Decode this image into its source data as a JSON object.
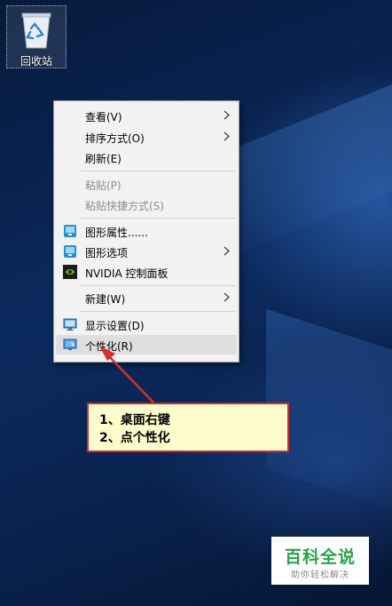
{
  "desktop": {
    "recycle_bin_label": "回收站"
  },
  "context_menu": {
    "items": [
      {
        "label": "查看(V)"
      },
      {
        "label": "排序方式(O)"
      },
      {
        "label": "刷新(E)"
      },
      {
        "label": "粘贴(P)"
      },
      {
        "label": "粘贴快捷方式(S)"
      },
      {
        "label": "图形属性......"
      },
      {
        "label": "图形选项"
      },
      {
        "label": "NVIDIA 控制面板"
      },
      {
        "label": "新建(W)"
      },
      {
        "label": "显示设置(D)"
      },
      {
        "label": "个性化(R)"
      }
    ],
    "highlighted_item": "个性化(R)"
  },
  "callout": {
    "line1": "1、桌面右键",
    "line2": "2、点个性化"
  },
  "watermark": {
    "title": "百科全说",
    "subtitle": "助你轻松解决"
  },
  "colors": {
    "callout_border": "#c9302c",
    "callout_bg": "#fefccd",
    "arrow": "#d0312d",
    "watermark_green": "#2aa14a"
  }
}
